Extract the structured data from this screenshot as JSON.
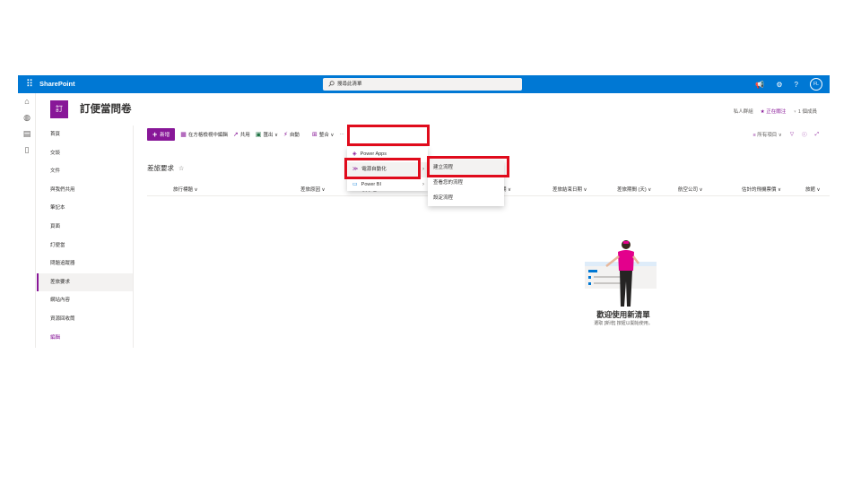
{
  "suitebar": {
    "app_name": "SharePoint",
    "search_placeholder": "搜尋此清單",
    "avatar_initials": "FL"
  },
  "site": {
    "logo_text": "訂",
    "title": "訂便當問卷",
    "tools": [
      "私人群組",
      "★ 正在關注",
      "♀ 1 個成員"
    ]
  },
  "leftnav": {
    "items": [
      {
        "label": "首頁"
      },
      {
        "label": "交談"
      },
      {
        "label": "文件"
      },
      {
        "label": "與我們共用"
      },
      {
        "label": "筆記本"
      },
      {
        "label": "頁面"
      },
      {
        "label": "訂便當"
      },
      {
        "label": "問題追蹤器"
      },
      {
        "label": "差旅要求"
      },
      {
        "label": "網站內容"
      },
      {
        "label": "資源回收筒"
      },
      {
        "label": "編輯"
      }
    ],
    "selected": "差旅要求"
  },
  "commandbar": {
    "new_label": "新增",
    "grid_edit_label": "在方格檢視中編輯",
    "share_label": "共用",
    "export_label": "匯出 ∨",
    "automate_label": "自動",
    "integrate_label": "整合 ∨",
    "more_label": "···",
    "view_label": "所有項目 ∨",
    "filter_icon": "filter-icon",
    "info_icon": "info-icon",
    "expand_icon": "expand-icon"
  },
  "list": {
    "title": "差旅要求",
    "favorite_icon": "☆",
    "columns": [
      "旅行標題 ∨",
      "差旅原因 ∨",
      "要求者",
      "動日期 ∨",
      "差旅結束日期 ∨",
      "差旅期間 (天) ∨",
      "航空公司 ∨",
      "估計的飛機票價 ∨",
      "旅館 ∨"
    ]
  },
  "menu_integrate": {
    "items": [
      {
        "label": "Power Apps",
        "icon": "power-apps-icon"
      },
      {
        "label": "電源自動化",
        "icon": "power-automate-icon",
        "submenu": true
      },
      {
        "label": "Power BI",
        "icon": "power-bi-icon",
        "submenu": true
      }
    ]
  },
  "menu_automate": {
    "items": [
      {
        "label": "建立流程"
      },
      {
        "label": "查看您的流程"
      },
      {
        "label": "設定流程"
      }
    ]
  },
  "empty_state": {
    "title": "歡迎使用新清單",
    "subtitle": "選取 [新增] 按鈕以開始使用。"
  },
  "colors": {
    "suitebar": "#0078d4",
    "accent": "#881798",
    "highlight": "#e00b1c"
  }
}
